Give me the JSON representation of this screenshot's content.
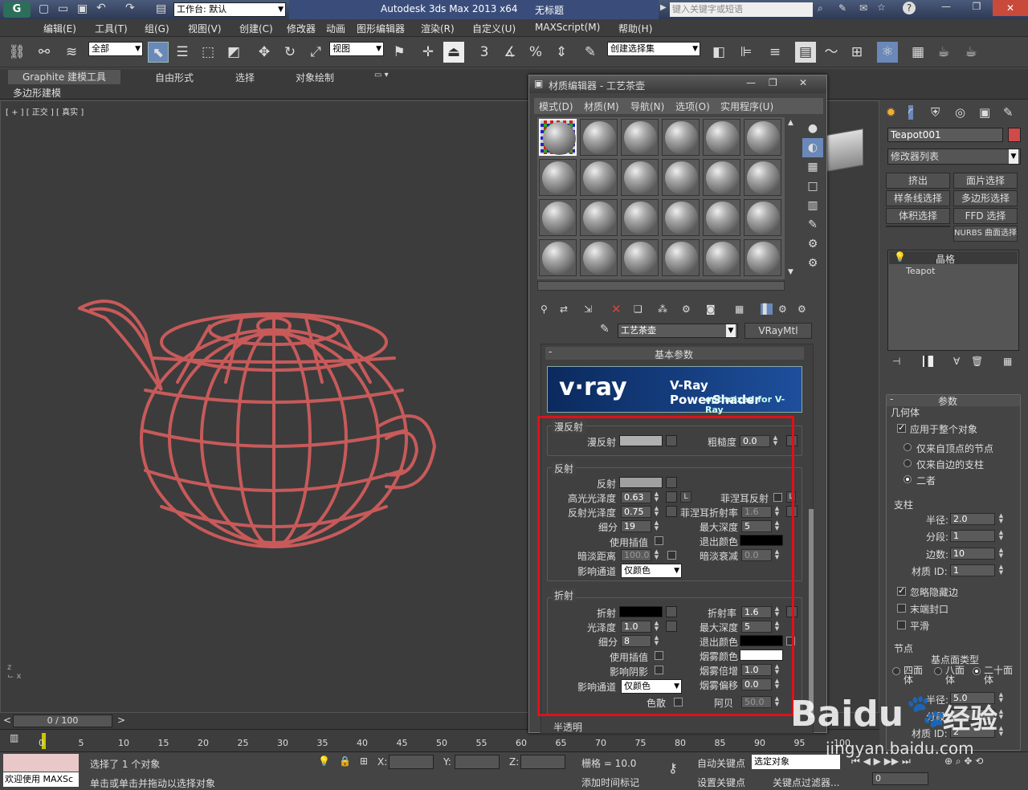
{
  "title": {
    "app": "Autodesk 3ds Max  2013 x64",
    "doc": "无标题",
    "workspace": "工作台: 默认",
    "search_placeholder": "键入关键字或短语"
  },
  "menu": [
    "编辑(E)",
    "工具(T)",
    "组(G)",
    "视图(V)",
    "创建(C)",
    "修改器",
    "动画",
    "图形编辑器",
    "渲染(R)",
    "自定义(U)",
    "MAXScript(M)",
    "帮助(H)"
  ],
  "toolbar": {
    "filter": "全部",
    "refcoord": "视图",
    "selection_set": "创建选择集",
    "snap3": "3",
    "angle": "%",
    "pct": "%"
  },
  "ribbon": {
    "tabs": [
      "Graphite 建模工具",
      "自由形式",
      "选择",
      "对象绘制"
    ],
    "sub": "多边形建模"
  },
  "viewport": {
    "label": "[ + ] [ 正交 ] [ 真实 ]"
  },
  "timeline": {
    "frame": "0 / 100",
    "ticks": [
      "0",
      "5",
      "10",
      "15",
      "20",
      "25",
      "30",
      "35",
      "40",
      "45",
      "50",
      "55",
      "60",
      "65",
      "70",
      "75",
      "80",
      "85",
      "90",
      "95",
      "100"
    ]
  },
  "status": {
    "script": "欢迎使用 MAXSc",
    "selected": "选择了 1 个对象",
    "prompt": "单击或单击并拖动以选择对象",
    "x": "X:",
    "y": "Y:",
    "z": "Z:",
    "grid": "栅格 = 10.0",
    "addtime": "添加时间标记",
    "autokey": "自动关键点",
    "setkey": "设置关键点",
    "selobj": "选定对象",
    "keyfilter": "关键点过滤器...",
    "frame": "0"
  },
  "cmd": {
    "object": "Teapot001",
    "color": "#d04a4a",
    "modlist": "修改器列表",
    "mods": [
      "挤出",
      "面片选择",
      "样条线选择",
      "多边形选择",
      "体积选择",
      "FFD 选择",
      "",
      "NURBS 曲面选择"
    ],
    "stack": [
      "晶格",
      "Teapot"
    ],
    "params_title": "参数",
    "geom": "几何体",
    "apply_all": "应用于整个对象",
    "opt1": "仅来自顶点的节点",
    "opt2": "仅来自边的支柱",
    "opt3": "二者",
    "struts": "支柱",
    "radius_l": "半径:",
    "radius_v": "2.0",
    "segs_l": "分段:",
    "segs_v": "1",
    "sides_l": "边数:",
    "sides_v": "10",
    "matid_l": "材质 ID:",
    "matid_v": "1",
    "ignore": "忽略隐藏边",
    "endcaps": "末端封口",
    "smooth": "平滑",
    "joints": "节点",
    "basetype": "基点面类型",
    "t4": "四面体",
    "t8": "八面体",
    "t20": "二十面体",
    "jradius_l": "半径:",
    "jradius_v": "5.0",
    "jseg_l": "分段:",
    "jmat_l": "材质 ID:",
    "jmat_v": "2"
  },
  "mat": {
    "title": "材质编辑器 - 工艺茶壶",
    "menu": [
      "模式(D)",
      "材质(M)",
      "导航(N)",
      "选项(O)",
      "实用程序(U)"
    ],
    "name": "工艺茶壶",
    "type": "VRayMtl",
    "rollout": "基本参数",
    "banner_title": "V-Ray PowerShader",
    "banner_sub": "optimized for V-Ray",
    "vray_logo": "v·ray",
    "diffuse_grp": "漫反射",
    "diffuse": "漫反射",
    "roughness": "粗糙度",
    "roughness_v": "0.0",
    "refl_grp": "反射",
    "refl": "反射",
    "hilight": "高光光泽度",
    "hilight_v": "0.63",
    "fresnel": "菲涅耳反射",
    "refl_gloss": "反射光泽度",
    "refl_gloss_v": "0.75",
    "fresnel_ior": "菲涅耳折射率",
    "fresnel_ior_v": "1.6",
    "subdivs": "细分",
    "subdivs_v": "19",
    "maxdepth": "最大深度",
    "maxdepth_v": "5",
    "interp": "使用插值",
    "exitcolor": "退出颜色",
    "dimdist": "暗淡距离",
    "dimdist_v": "100.0",
    "dimfall": "暗淡衰减",
    "dimfall_v": "0.0",
    "affect": "影响通道",
    "affect_v": "仅颜色",
    "refr_grp": "折射",
    "refr": "折射",
    "ior": "折射率",
    "ior_v": "1.6",
    "gloss": "光泽度",
    "gloss_v": "1.0",
    "r_maxdepth": "最大深度",
    "r_maxdepth_v": "5",
    "r_subdivs": "细分",
    "r_subdivs_v": "8",
    "r_exit": "退出颜色",
    "r_interp": "使用插值",
    "fogcolor": "烟雾颜色",
    "shadows": "影响阴影",
    "fogmult": "烟雾倍增",
    "fogmult_v": "1.0",
    "r_affect": "影响通道",
    "r_affect_v": "仅颜色",
    "fogbias": "烟雾偏移",
    "fogbias_v": "0.0",
    "disp": "色散",
    "abbe": "阿贝",
    "abbe_v": "50.0",
    "translucent": "半透明",
    "L": "L"
  },
  "watermark": {
    "baidu": "Baidu",
    "jingyan": "经验",
    "url": "jingyan.baidu.com"
  },
  "colors": {
    "teapot": "#c85a5a",
    "highlight": "#e0101a",
    "accent": "#6688bb"
  }
}
